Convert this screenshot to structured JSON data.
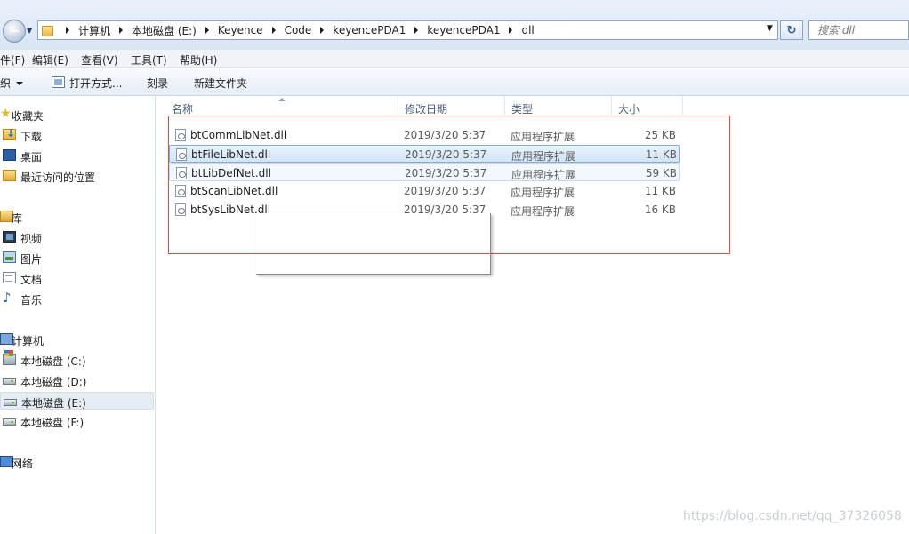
{
  "address_bar": {
    "crumbs": [
      "计算机",
      "本地磁盘 (E:)",
      "Keyence",
      "Code",
      "keyencePDA1",
      "keyencePDA1",
      "dll"
    ],
    "search_placeholder": "搜索 dll"
  },
  "menubar": {
    "items": [
      "件(F)",
      "编辑(E)",
      "查看(V)",
      "工具(T)",
      "帮助(H)"
    ]
  },
  "toolbar": {
    "organize": "织",
    "open_with": "打开方式...",
    "burn": "刻录",
    "new_folder": "新建文件夹"
  },
  "nav": {
    "items": [
      {
        "label": "收藏夹",
        "icon": "star-icon"
      },
      {
        "label": "下载",
        "icon": "downloads-folder-icon"
      },
      {
        "label": "桌面",
        "icon": "desktop-icon"
      },
      {
        "label": "最近访问的位置",
        "icon": "recent-places-icon"
      },
      {
        "label": "库",
        "icon": "library-icon"
      },
      {
        "label": "视频",
        "icon": "video-icon"
      },
      {
        "label": "图片",
        "icon": "picture-icon"
      },
      {
        "label": "文档",
        "icon": "document-icon"
      },
      {
        "label": "音乐",
        "icon": "music-icon"
      },
      {
        "label": "计算机",
        "icon": "computer-icon"
      },
      {
        "label": "本地磁盘 (C:)",
        "icon": "system-drive-icon"
      },
      {
        "label": "本地磁盘 (D:)",
        "icon": "drive-icon"
      },
      {
        "label": "本地磁盘 (E:)",
        "icon": "drive-icon",
        "selected": true
      },
      {
        "label": "本地磁盘 (F:)",
        "icon": "drive-icon"
      },
      {
        "label": "网络",
        "icon": "network-icon"
      }
    ]
  },
  "columns": {
    "name": "名称",
    "date": "修改日期",
    "type": "类型",
    "size": "大小"
  },
  "files": [
    {
      "name": "btCommLibNet.dll",
      "date": "2019/3/20 5:37",
      "type": "应用程序扩展",
      "size": "25 KB"
    },
    {
      "name": "btFileLibNet.dll",
      "date": "2019/3/20 5:37",
      "type": "应用程序扩展",
      "size": "11 KB",
      "selected": true
    },
    {
      "name": "btLibDefNet.dll",
      "date": "2019/3/20 5:37",
      "type": "应用程序扩展",
      "size": "59 KB",
      "hover": true
    },
    {
      "name": "btScanLibNet.dll",
      "date": "2019/3/20 5:37",
      "type": "应用程序扩展",
      "size": "11 KB"
    },
    {
      "name": "btSysLibNet.dll",
      "date": "2019/3/20 5:37",
      "type": "应用程序扩展",
      "size": "16 KB"
    }
  ],
  "watermark": "https://blog.csdn.net/qq_37326058",
  "colors": {
    "selection_border": "#84acdd",
    "annotation_red": "#e04b4b",
    "header_text": "#4c607a"
  }
}
